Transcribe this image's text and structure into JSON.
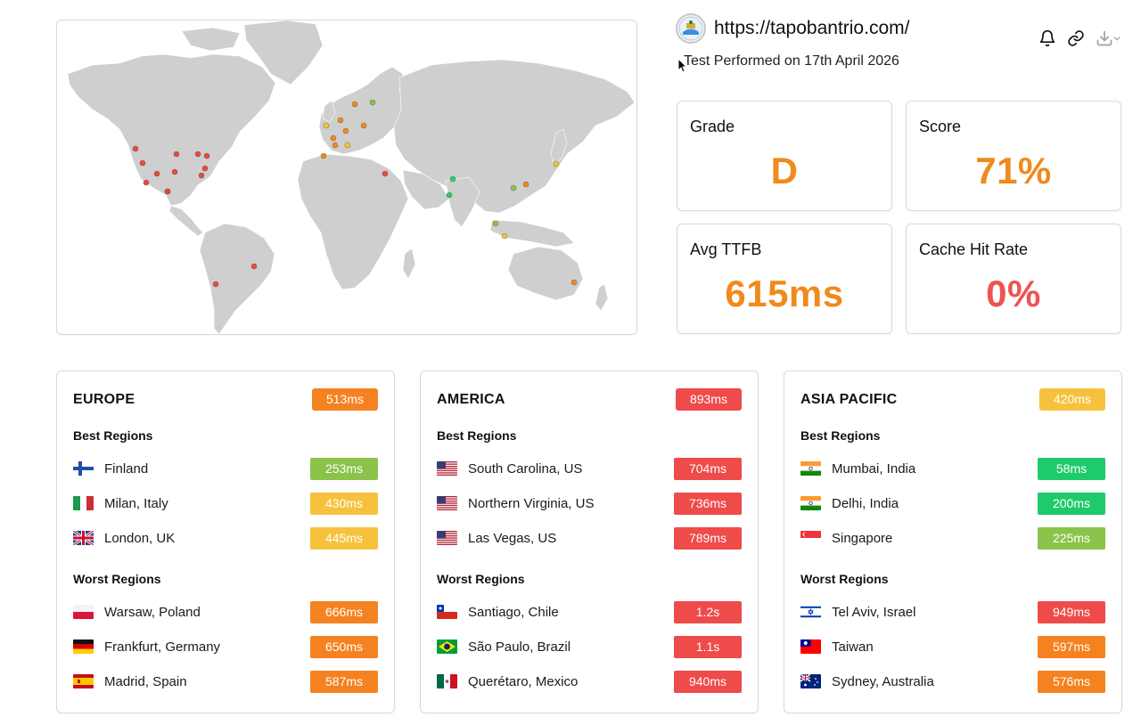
{
  "header": {
    "site_url": "https://tapobantrio.com/",
    "test_date": "Test Performed on 17th April 2026",
    "icons": [
      "bell-icon",
      "link-icon",
      "download-icon",
      "chevron-down-icon"
    ]
  },
  "metrics": {
    "grade": {
      "label": "Grade",
      "value": "D",
      "color": "#f08a1c"
    },
    "score": {
      "label": "Score",
      "value": "71%",
      "color": "#f08a1c"
    },
    "ttfb": {
      "label": "Avg TTFB",
      "value": "615ms",
      "color": "#f08a1c"
    },
    "cache": {
      "label": "Cache Hit Rate",
      "value": "0%",
      "color": "#ef5350"
    }
  },
  "map": {
    "markers": [
      {
        "location": "Seattle",
        "color": "#e74c3c"
      },
      {
        "location": "San Francisco",
        "color": "#e74c3c"
      },
      {
        "location": "Los Angeles",
        "color": "#e74c3c"
      },
      {
        "location": "Las Vegas",
        "color": "#e74c3c"
      },
      {
        "location": "Dallas",
        "color": "#e74c3c"
      },
      {
        "location": "Chicago",
        "color": "#e74c3c"
      },
      {
        "location": "Kansas",
        "color": "#e74c3c"
      },
      {
        "location": "Toronto",
        "color": "#e74c3c"
      },
      {
        "location": "New York",
        "color": "#e74c3c"
      },
      {
        "location": "Northern Virginia",
        "color": "#e74c3c"
      },
      {
        "location": "South Carolina",
        "color": "#e74c3c"
      },
      {
        "location": "Queretaro",
        "color": "#e74c3c"
      },
      {
        "location": "Santiago",
        "color": "#e74c3c"
      },
      {
        "location": "Sao Paulo",
        "color": "#e74c3c"
      },
      {
        "location": "London",
        "color": "#f4c430"
      },
      {
        "location": "Paris",
        "color": "#f08a1c"
      },
      {
        "location": "Amsterdam",
        "color": "#f08a1c"
      },
      {
        "location": "Frankfurt",
        "color": "#f08a1c"
      },
      {
        "location": "Zurich",
        "color": "#f08a1c"
      },
      {
        "location": "Milan",
        "color": "#f4c430"
      },
      {
        "location": "Madrid",
        "color": "#f08a1c"
      },
      {
        "location": "Warsaw",
        "color": "#f08a1c"
      },
      {
        "location": "Stockholm",
        "color": "#f08a1c"
      },
      {
        "location": "Finland",
        "color": "#8bc34a"
      },
      {
        "location": "Tel Aviv",
        "color": "#e74c3c"
      },
      {
        "location": "Delhi",
        "color": "#2ecc71"
      },
      {
        "location": "Mumbai",
        "color": "#2ecc71"
      },
      {
        "location": "Singapore",
        "color": "#8bc34a"
      },
      {
        "location": "Jakarta",
        "color": "#f4c430"
      },
      {
        "location": "Hong Kong",
        "color": "#8bc34a"
      },
      {
        "location": "Taiwan",
        "color": "#f08a1c"
      },
      {
        "location": "Tokyo",
        "color": "#f4c430"
      },
      {
        "location": "Sydney",
        "color": "#f08a1c"
      }
    ]
  },
  "regions": [
    {
      "title": "EUROPE",
      "avg": "513ms",
      "avg_color": "#f58220",
      "best_label": "Best Regions",
      "worst_label": "Worst Regions",
      "best": [
        {
          "flag": "fi",
          "name": "Finland",
          "ms": "253ms",
          "color": "#8bc34a"
        },
        {
          "flag": "it",
          "name": "Milan, Italy",
          "ms": "430ms",
          "color": "#f6c23e"
        },
        {
          "flag": "gb",
          "name": "London, UK",
          "ms": "445ms",
          "color": "#f6c23e"
        }
      ],
      "worst": [
        {
          "flag": "pl",
          "name": "Warsaw, Poland",
          "ms": "666ms",
          "color": "#f58220"
        },
        {
          "flag": "de",
          "name": "Frankfurt, Germany",
          "ms": "650ms",
          "color": "#f58220"
        },
        {
          "flag": "es",
          "name": "Madrid, Spain",
          "ms": "587ms",
          "color": "#f58220"
        }
      ]
    },
    {
      "title": "AMERICA",
      "avg": "893ms",
      "avg_color": "#ef4b4b",
      "best_label": "Best Regions",
      "worst_label": "Worst Regions",
      "best": [
        {
          "flag": "us",
          "name": "South Carolina, US",
          "ms": "704ms",
          "color": "#ef4b4b"
        },
        {
          "flag": "us",
          "name": "Northern Virginia, US",
          "ms": "736ms",
          "color": "#ef4b4b"
        },
        {
          "flag": "us",
          "name": "Las Vegas, US",
          "ms": "789ms",
          "color": "#ef4b4b"
        }
      ],
      "worst": [
        {
          "flag": "cl",
          "name": "Santiago, Chile",
          "ms": "1.2s",
          "color": "#ef4b4b"
        },
        {
          "flag": "br",
          "name": "São Paulo, Brazil",
          "ms": "1.1s",
          "color": "#ef4b4b"
        },
        {
          "flag": "mx",
          "name": "Querétaro, Mexico",
          "ms": "940ms",
          "color": "#ef4b4b"
        }
      ]
    },
    {
      "title": "ASIA PACIFIC",
      "avg": "420ms",
      "avg_color": "#f6c23e",
      "best_label": "Best Regions",
      "worst_label": "Worst Regions",
      "best": [
        {
          "flag": "in",
          "name": "Mumbai, India",
          "ms": "58ms",
          "color": "#1fca6b"
        },
        {
          "flag": "in",
          "name": "Delhi, India",
          "ms": "200ms",
          "color": "#1fca6b"
        },
        {
          "flag": "sg",
          "name": "Singapore",
          "ms": "225ms",
          "color": "#8bc34a"
        }
      ],
      "worst": [
        {
          "flag": "il",
          "name": "Tel Aviv, Israel",
          "ms": "949ms",
          "color": "#ef4b4b"
        },
        {
          "flag": "tw",
          "name": "Taiwan",
          "ms": "597ms",
          "color": "#f58220"
        },
        {
          "flag": "au",
          "name": "Sydney, Australia",
          "ms": "576ms",
          "color": "#f58220"
        }
      ]
    }
  ]
}
